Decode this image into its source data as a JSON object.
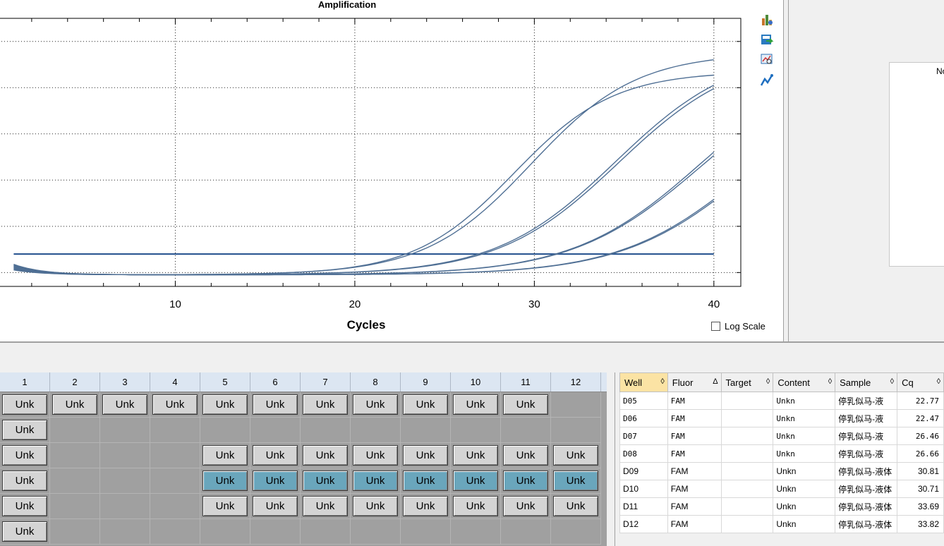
{
  "chart": {
    "title": "Amplification",
    "xlabel": "Cycles",
    "x_tick_labels": [
      "10",
      "20",
      "30",
      "40"
    ],
    "log_scale_label": "Log Scale",
    "log_scale_checked": false,
    "threshold_color": "#1f4e8c",
    "curve_color": "#4f6f94"
  },
  "chart_data": {
    "type": "line",
    "title": "Amplification",
    "xlabel": "Cycles",
    "ylabel": "",
    "xlim": [
      1,
      40
    ],
    "ylim": [
      -0.05,
      1.0
    ],
    "grid": true,
    "threshold": 0.08,
    "series": [
      {
        "cq": 22.77,
        "plateau": 0.96,
        "k": 0.34
      },
      {
        "cq": 22.47,
        "plateau": 0.88,
        "k": 0.36
      },
      {
        "cq": 26.46,
        "plateau": 0.98,
        "k": 0.3
      },
      {
        "cq": 26.66,
        "plateau": 0.97,
        "k": 0.3
      },
      {
        "cq": 30.81,
        "plateau": 0.94,
        "k": 0.28
      },
      {
        "cq": 30.71,
        "plateau": 0.97,
        "k": 0.28
      },
      {
        "cq": 33.69,
        "plateau": 0.9,
        "k": 0.28
      },
      {
        "cq": 33.82,
        "plateau": 0.9,
        "k": 0.28
      }
    ]
  },
  "right_panel": {
    "label": "No"
  },
  "plate": {
    "columns": [
      "1",
      "2",
      "3",
      "4",
      "5",
      "6",
      "7",
      "8",
      "9",
      "10",
      "11",
      "12"
    ],
    "rows": [
      [
        "Unk",
        "Unk",
        "Unk",
        "Unk",
        "Unk",
        "Unk",
        "Unk",
        "Unk",
        "Unk",
        "Unk",
        "Unk",
        ""
      ],
      [
        "Unk",
        "",
        "",
        "",
        "",
        "",
        "",
        "",
        "",
        "",
        "",
        ""
      ],
      [
        "Unk",
        "",
        "",
        "",
        "Unk",
        "Unk",
        "Unk",
        "Unk",
        "Unk",
        "Unk",
        "Unk",
        "Unk"
      ],
      [
        "Unk",
        "",
        "",
        "",
        "Unk",
        "Unk",
        "Unk",
        "Unk",
        "Unk",
        "Unk",
        "Unk",
        "Unk"
      ],
      [
        "Unk",
        "",
        "",
        "",
        "Unk",
        "Unk",
        "Unk",
        "Unk",
        "Unk",
        "Unk",
        "Unk",
        "Unk"
      ],
      [
        "Unk",
        "",
        "",
        "",
        "",
        "",
        "",
        "",
        "",
        "",
        "",
        ""
      ]
    ],
    "selected_row": 3,
    "selected_from_col": 4
  },
  "results": {
    "headers": [
      {
        "label": "Well",
        "sort": "◊"
      },
      {
        "label": "Fluor",
        "sort": "Δ"
      },
      {
        "label": "Target",
        "sort": "◊"
      },
      {
        "label": "Content",
        "sort": "◊"
      },
      {
        "label": "Sample",
        "sort": "◊"
      },
      {
        "label": "Cq",
        "sort": "◊"
      }
    ],
    "rows": [
      {
        "well": "D05",
        "fluor": "FAM",
        "target": "",
        "content": "Unkn",
        "sample": "停乳似马-液",
        "cq": "22.77"
      },
      {
        "well": "D06",
        "fluor": "FAM",
        "target": "",
        "content": "Unkn",
        "sample": "停乳似马-液",
        "cq": "22.47"
      },
      {
        "well": "D07",
        "fluor": "FAM",
        "target": "",
        "content": "Unkn",
        "sample": "停乳似马-液",
        "cq": "26.46"
      },
      {
        "well": "D08",
        "fluor": "FAM",
        "target": "",
        "content": "Unkn",
        "sample": "停乳似马-液",
        "cq": "26.66"
      },
      {
        "well": "D09",
        "fluor": "FAM",
        "target": "",
        "content": "Unkn",
        "sample": "停乳似马-液体",
        "cq": "30.81"
      },
      {
        "well": "D10",
        "fluor": "FAM",
        "target": "",
        "content": "Unkn",
        "sample": "停乳似马-液体",
        "cq": "30.71"
      },
      {
        "well": "D11",
        "fluor": "FAM",
        "target": "",
        "content": "Unkn",
        "sample": "停乳似马-液体",
        "cq": "33.69"
      },
      {
        "well": "D12",
        "fluor": "FAM",
        "target": "",
        "content": "Unkn",
        "sample": "停乳似马-液体",
        "cq": "33.82"
      }
    ]
  },
  "toolbar": {
    "icons": [
      "copy-icon",
      "chart-settings-icon",
      "export-icon",
      "zoom-chart-icon",
      "curve-icon"
    ]
  }
}
